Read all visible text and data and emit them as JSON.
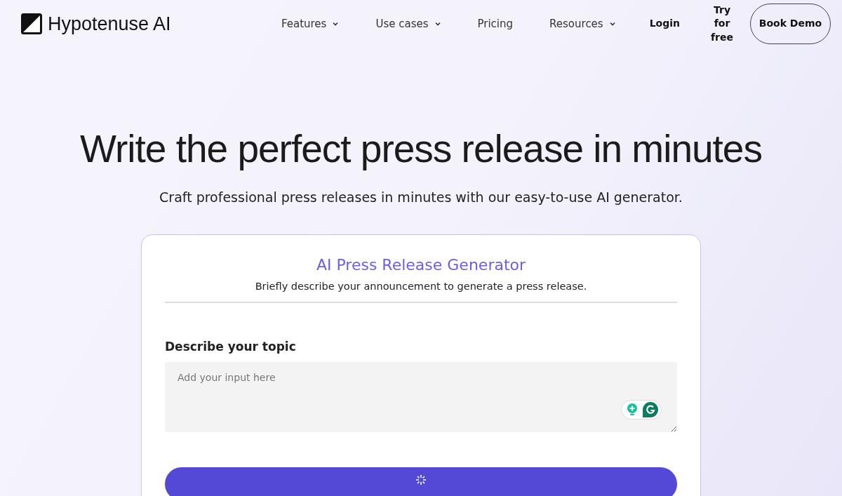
{
  "brand": {
    "name": "Hypotenuse AI"
  },
  "nav": [
    {
      "label": "Features",
      "kind": "dropdown"
    },
    {
      "label": "Use cases",
      "kind": "dropdown"
    },
    {
      "label": "Pricing",
      "kind": "link"
    },
    {
      "label": "Resources",
      "kind": "dropdown"
    },
    {
      "label": "Login",
      "kind": "strong"
    },
    {
      "label": "Try for free",
      "kind": "strong"
    },
    {
      "label": "Book Demo",
      "kind": "outlined"
    }
  ],
  "hero": {
    "title": "Write the perfect press release in minutes",
    "subtitle": "Craft professional press releases in minutes with our easy-to-use AI generator."
  },
  "generator": {
    "title": "AI Press Release Generator",
    "description": "Briefly describe your announcement to generate a press release.",
    "field_label": "Describe your topic",
    "placeholder": "Add your input here"
  }
}
